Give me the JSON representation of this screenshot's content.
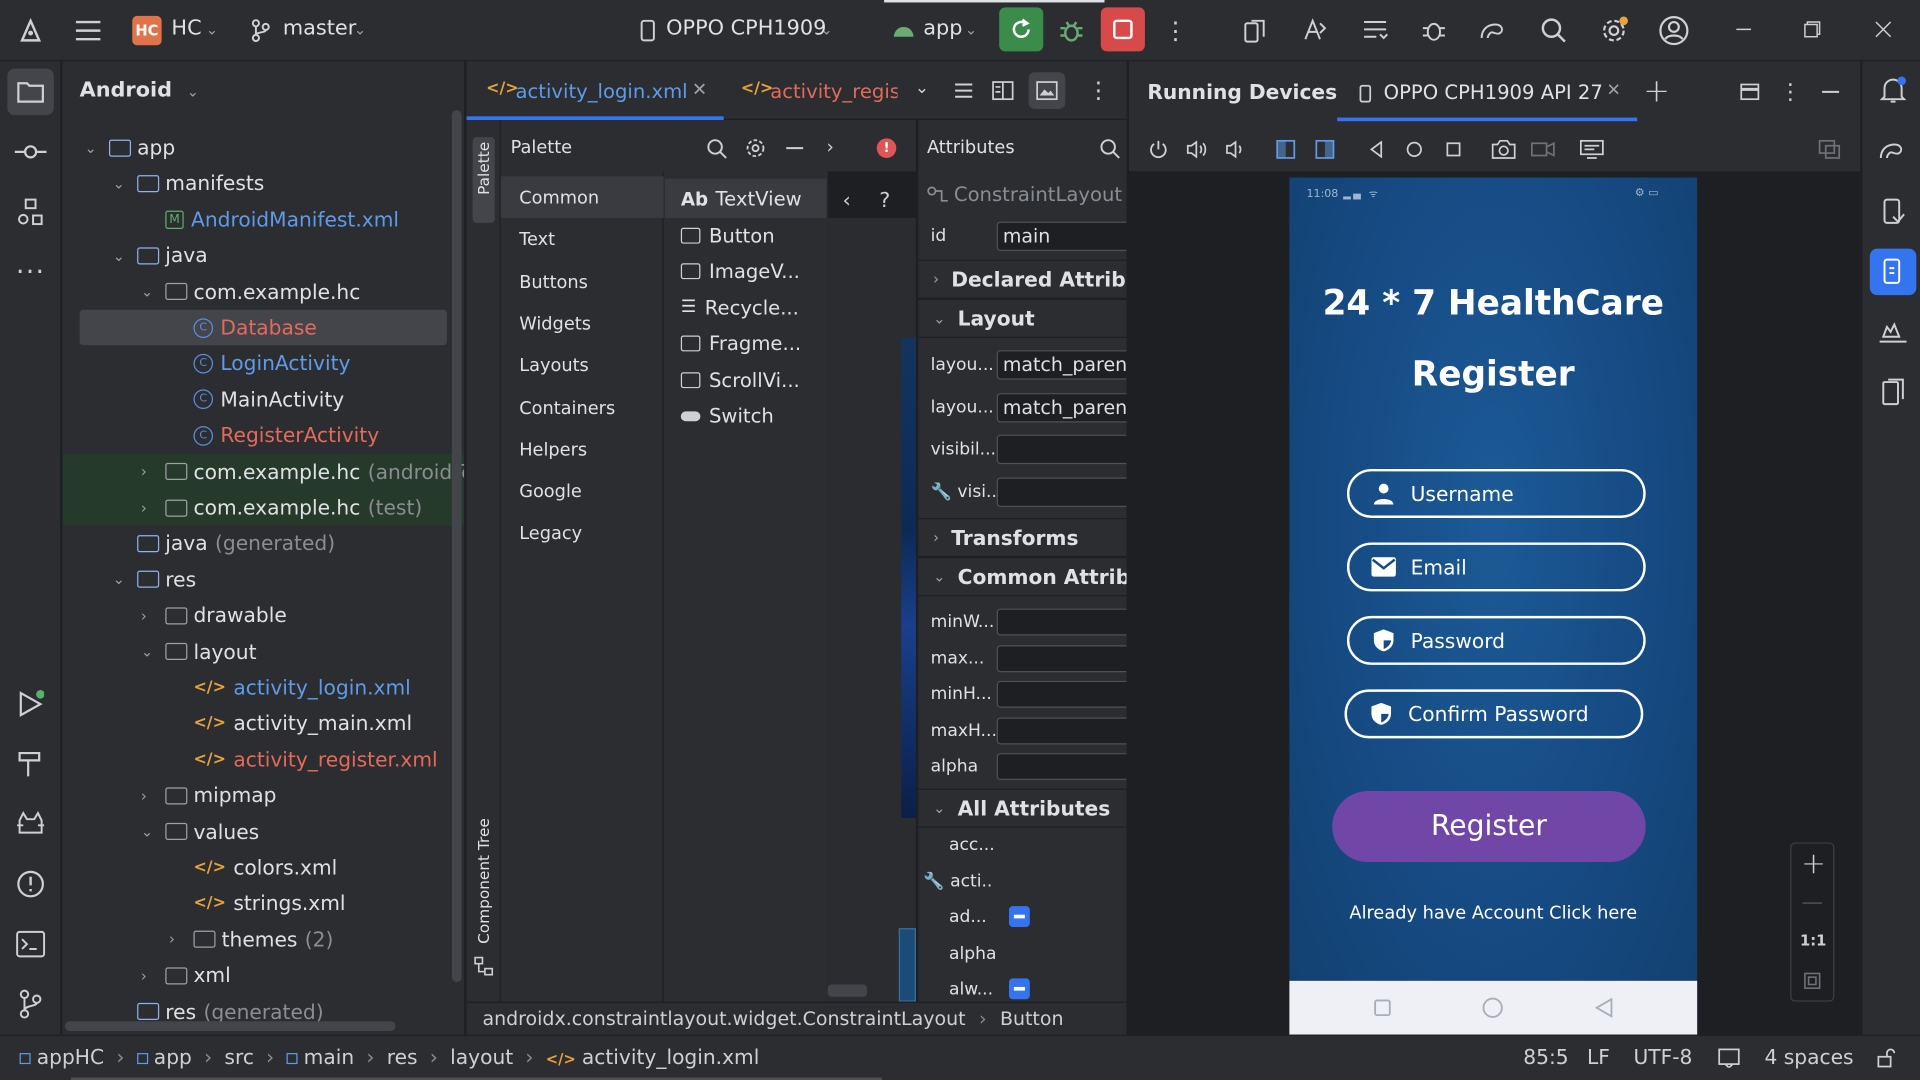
{
  "titlebar": {
    "project_badge": "HC",
    "project_name": "HC",
    "branch": "master",
    "device": "OPPO CPH1909",
    "run_config": "app"
  },
  "left_toolbar": {
    "icons": [
      "project-folder-icon",
      "commit-icon",
      "structure-icon",
      "more-icon",
      "run-icon",
      "build-icon",
      "logcat-icon",
      "problems-icon",
      "terminal-icon",
      "git-icon"
    ]
  },
  "project": {
    "view": "Android",
    "tree": [
      {
        "indent": 0,
        "chev": "v",
        "icon": "folder",
        "label": "app",
        "color": "default"
      },
      {
        "indent": 1,
        "chev": "v",
        "icon": "folder",
        "label": "manifests",
        "color": "default"
      },
      {
        "indent": 2,
        "chev": "",
        "icon": "manifest",
        "label": "AndroidManifest.xml",
        "color": "blue"
      },
      {
        "indent": 1,
        "chev": "v",
        "icon": "folder",
        "label": "java",
        "color": "default"
      },
      {
        "indent": 2,
        "chev": "v",
        "icon": "package",
        "label": "com.example.hc",
        "color": "default"
      },
      {
        "indent": 3,
        "chev": "",
        "icon": "class",
        "label": "Database",
        "color": "red",
        "selected": true
      },
      {
        "indent": 3,
        "chev": "",
        "icon": "class",
        "label": "LoginActivity",
        "color": "blue"
      },
      {
        "indent": 3,
        "chev": "",
        "icon": "class",
        "label": "MainActivity",
        "color": "default"
      },
      {
        "indent": 3,
        "chev": "",
        "icon": "class",
        "label": "RegisterActivity",
        "color": "red"
      },
      {
        "indent": 2,
        "chev": ">",
        "icon": "package",
        "label": "com.example.hc",
        "suffix": "(androidTest)",
        "color": "default",
        "green": true
      },
      {
        "indent": 2,
        "chev": ">",
        "icon": "package",
        "label": "com.example.hc",
        "suffix": "(test)",
        "color": "default",
        "green": true
      },
      {
        "indent": 1,
        "chev": "",
        "icon": "folder",
        "label": "java",
        "suffix": "(generated)",
        "color": "default"
      },
      {
        "indent": 1,
        "chev": "v",
        "icon": "folder",
        "label": "res",
        "color": "default"
      },
      {
        "indent": 2,
        "chev": ">",
        "icon": "package",
        "label": "drawable",
        "color": "default"
      },
      {
        "indent": 2,
        "chev": "v",
        "icon": "package",
        "label": "layout",
        "color": "default"
      },
      {
        "indent": 3,
        "chev": "",
        "icon": "xml",
        "label": "activity_login.xml",
        "color": "blue"
      },
      {
        "indent": 3,
        "chev": "",
        "icon": "xml",
        "label": "activity_main.xml",
        "color": "default"
      },
      {
        "indent": 3,
        "chev": "",
        "icon": "xml",
        "label": "activity_register.xml",
        "color": "red"
      },
      {
        "indent": 2,
        "chev": ">",
        "icon": "package",
        "label": "mipmap",
        "color": "default"
      },
      {
        "indent": 2,
        "chev": "v",
        "icon": "package",
        "label": "values",
        "color": "default"
      },
      {
        "indent": 3,
        "chev": "",
        "icon": "xml",
        "label": "colors.xml",
        "color": "default"
      },
      {
        "indent": 3,
        "chev": "",
        "icon": "xml",
        "label": "strings.xml",
        "color": "default"
      },
      {
        "indent": 3,
        "chev": ">",
        "icon": "package",
        "label": "themes",
        "suffix": "(2)",
        "color": "default"
      },
      {
        "indent": 2,
        "chev": ">",
        "icon": "package",
        "label": "xml",
        "color": "default"
      },
      {
        "indent": 1,
        "chev": "",
        "icon": "folder",
        "label": "res",
        "suffix": "(generated)",
        "color": "default"
      }
    ]
  },
  "editor": {
    "tabs": [
      {
        "label": "activity_login.xml",
        "active": true
      },
      {
        "label": "activity_regis",
        "active": false
      }
    ],
    "palette_strip_label": "Palette",
    "component_tree_label": "Component Tree",
    "palette_title": "Palette",
    "categories": [
      "Common",
      "Text",
      "Buttons",
      "Widgets",
      "Layouts",
      "Containers",
      "Helpers",
      "Google",
      "Legacy"
    ],
    "widgets": [
      {
        "icon": "Ab",
        "label": "TextView"
      },
      {
        "icon": "button",
        "label": "Button"
      },
      {
        "icon": "image",
        "label": "ImageV..."
      },
      {
        "icon": "list",
        "label": "Recycle..."
      },
      {
        "icon": "frag",
        "label": "Fragme..."
      },
      {
        "icon": "scroll",
        "label": "ScrollVi..."
      },
      {
        "icon": "switch",
        "label": "Switch"
      }
    ],
    "attributes": {
      "title": "Attributes",
      "component": "ConstraintLayout",
      "id_key": "id",
      "id_value": "main",
      "sections": {
        "declared": "Declared Attrib...",
        "layout": "Layout",
        "transforms": "Transforms",
        "common": "Common Attribut",
        "all": "All Attributes"
      },
      "layout_rows": [
        {
          "k": "layou...",
          "v": "match_parent"
        },
        {
          "k": "layou...",
          "v": "match_parent"
        },
        {
          "k": "visibil...",
          "v": ""
        },
        {
          "k": "visi...",
          "v": ""
        }
      ],
      "common_rows": [
        {
          "k": "minW...",
          "v": ""
        },
        {
          "k": "max...",
          "v": ""
        },
        {
          "k": "minH...",
          "v": ""
        },
        {
          "k": "maxH...",
          "v": ""
        },
        {
          "k": "alpha",
          "v": ""
        }
      ],
      "all_rows": [
        "acc...",
        "acti...",
        "ad...",
        "alpha",
        "alw..."
      ]
    },
    "breadcrumb": [
      "androidx.constraintlayout.widget.ConstraintLayout",
      "Button"
    ]
  },
  "running_devices": {
    "title": "Running Devices",
    "tab": "OPPO CPH1909 API 27",
    "status_time": "11:08",
    "app_title": "24 * 7 HealthCare",
    "screen_title": "Register",
    "fields": [
      "Username",
      "Email",
      "Password",
      "Confirm Password"
    ],
    "register_button": "Register",
    "login_link": "Already have Account Click here",
    "zoom_label": "1:1"
  },
  "statusbar": {
    "path": [
      "appHC",
      "app",
      "src",
      "main",
      "res",
      "layout",
      "activity_login.xml"
    ],
    "position": "85:5",
    "line_ending": "LF",
    "encoding": "UTF-8",
    "indent": "4 spaces"
  },
  "colors": {
    "accent": "#3574f0",
    "run_green": "#3b8c4a",
    "stop_red": "#d84a4a",
    "phone_blue": "#164a82",
    "register_purple": "#7046a6"
  }
}
